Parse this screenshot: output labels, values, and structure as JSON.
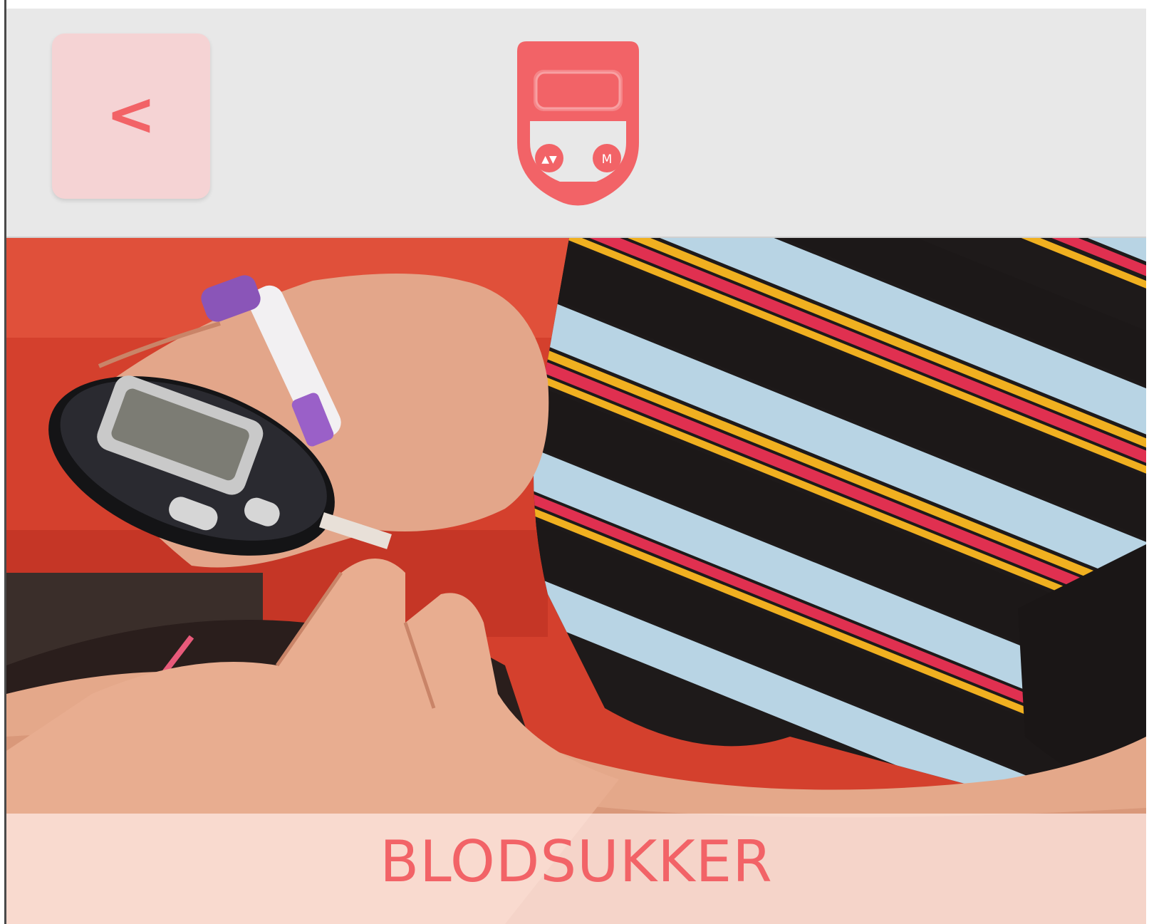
{
  "header": {
    "back_label": "<",
    "logo_icon": "glucose-meter-icon",
    "logo_button_up_down": "▲▼",
    "logo_button_m": "M"
  },
  "hero": {
    "image_icon": "blood-glucose-test-photo",
    "title": "BLODSUKKER"
  },
  "colors": {
    "accent": "#f26367",
    "header_bg": "#e8e8e8",
    "back_button_bg": "#f5d3d4",
    "title_band_bg": "#ffece8"
  }
}
